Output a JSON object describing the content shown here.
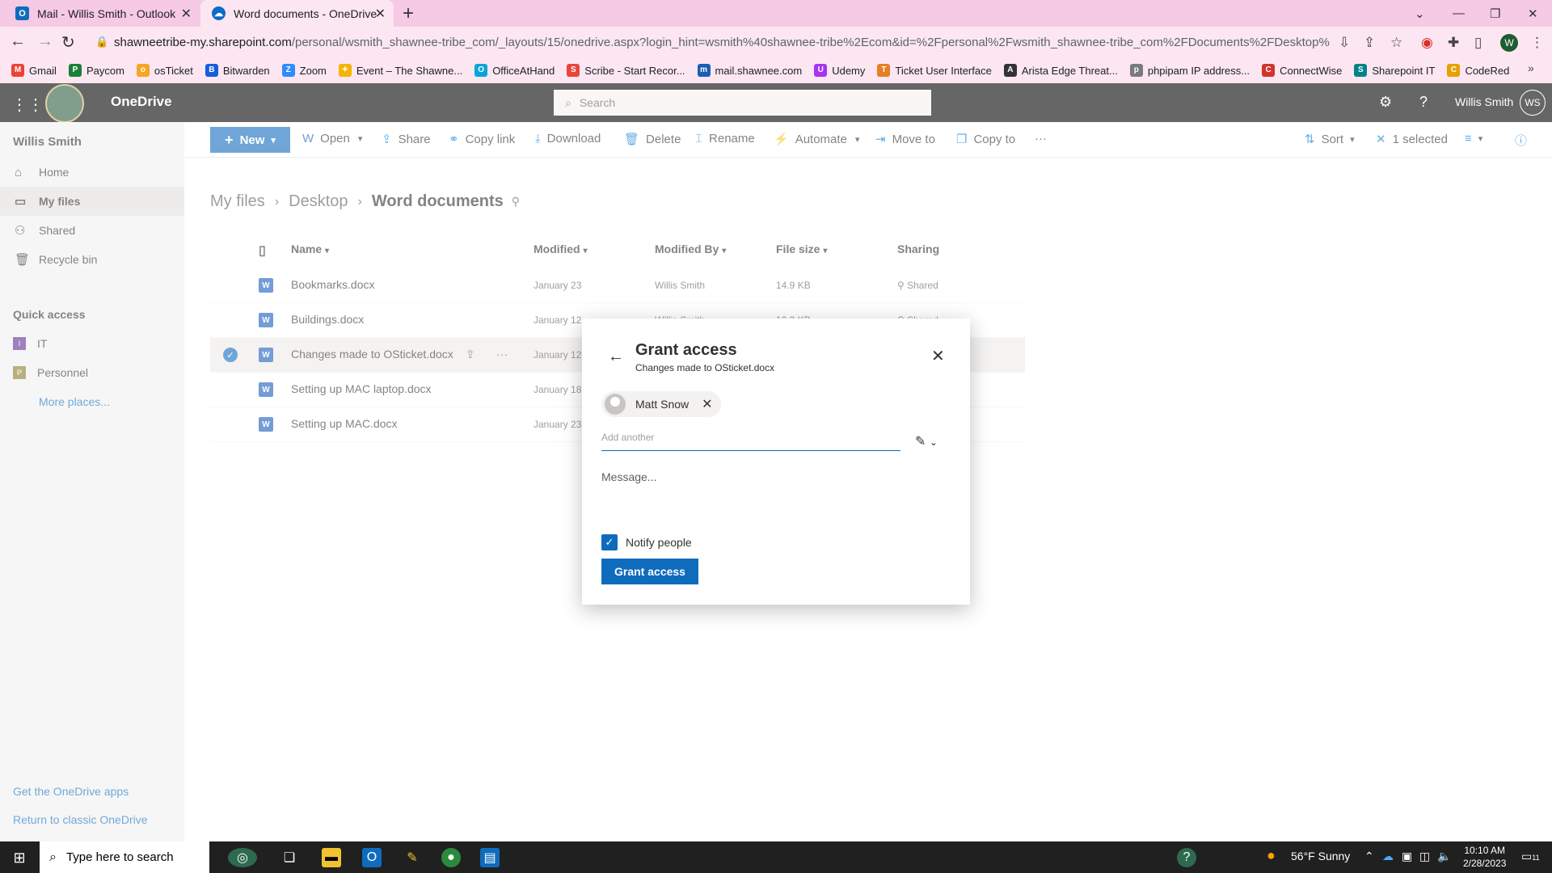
{
  "browser": {
    "tabs": [
      {
        "title": "Mail - Willis Smith - Outlook",
        "icon": "outlook-icon"
      },
      {
        "title": "Word documents - OneDrive",
        "icon": "onedrive-icon"
      }
    ],
    "url_host": "shawneetribe-my.sharepoint.com",
    "url_rest": "/personal/wsmith_shawnee-tribe_com/_layouts/15/onedrive.aspx?login_hint=wsmith%40shawnee-tribe%2Ecom&id=%2Fpersonal%2Fwsmith_shawnee-tribe_com%2FDocuments%2FDesktop%2FWord%20docu...",
    "profile_initial": "W",
    "bookmarks": [
      {
        "label": "Gmail",
        "color": "#ea4335",
        "glyph": "M"
      },
      {
        "label": "Paycom",
        "color": "#1a7f37",
        "glyph": "P"
      },
      {
        "label": "osTicket",
        "color": "#f5a623",
        "glyph": "o"
      },
      {
        "label": "Bitwarden",
        "color": "#175ddc",
        "glyph": "B"
      },
      {
        "label": "Zoom",
        "color": "#2d8cff",
        "glyph": "Z"
      },
      {
        "label": "Event – The Shawne...",
        "color": "#f4b400",
        "glyph": "✦"
      },
      {
        "label": "OfficeAtHand",
        "color": "#0aa5d8",
        "glyph": "O"
      },
      {
        "label": "Scribe - Start Recor...",
        "color": "#e8453c",
        "glyph": "S"
      },
      {
        "label": "mail.shawnee.com",
        "color": "#1a5fb4",
        "glyph": "m"
      },
      {
        "label": "Udemy",
        "color": "#a435f0",
        "glyph": "U"
      },
      {
        "label": "Ticket User Interface",
        "color": "#e67e22",
        "glyph": "T"
      },
      {
        "label": "Arista Edge Threat...",
        "color": "#333333",
        "glyph": "A"
      },
      {
        "label": "phpipam IP address...",
        "color": "#7a7a7a",
        "glyph": "p"
      },
      {
        "label": "ConnectWise",
        "color": "#d0342c",
        "glyph": "C"
      },
      {
        "label": "Sharepoint IT",
        "color": "#038387",
        "glyph": "S"
      },
      {
        "label": "CodeRed",
        "color": "#e5a100",
        "glyph": "C"
      }
    ]
  },
  "header": {
    "app_name": "OneDrive",
    "search_placeholder": "Search",
    "user_name": "Willis Smith",
    "user_initials": "WS"
  },
  "sidebar": {
    "owner": "Willis Smith",
    "items": [
      {
        "label": "Home",
        "icon": "home-icon",
        "glyph": "⌂"
      },
      {
        "label": "My files",
        "icon": "folder-icon",
        "glyph": "▭"
      },
      {
        "label": "Shared",
        "icon": "people-icon",
        "glyph": "⚇"
      },
      {
        "label": "Recycle bin",
        "icon": "trash-icon",
        "glyph": "🗑"
      }
    ],
    "quick_access_title": "Quick access",
    "quick_access": [
      {
        "label": "IT",
        "color": "#5c2e91",
        "glyph": "I"
      },
      {
        "label": "Personnel",
        "color": "#8a7a2e",
        "glyph": "P"
      }
    ],
    "more_places": "More places...",
    "get_apps": "Get the OneDrive apps",
    "return_classic": "Return to classic OneDrive"
  },
  "commands": {
    "new": "New",
    "open": "Open",
    "share": "Share",
    "copy_link": "Copy link",
    "download": "Download",
    "delete": "Delete",
    "rename": "Rename",
    "automate": "Automate",
    "move_to": "Move to",
    "copy_to": "Copy to",
    "more": "···",
    "sort": "Sort",
    "selected": "1 selected"
  },
  "breadcrumb": {
    "items": [
      "My files",
      "Desktop"
    ],
    "current": "Word documents"
  },
  "columns": {
    "name": "Name",
    "modified": "Modified",
    "modified_by": "Modified By",
    "file_size": "File size",
    "sharing": "Sharing"
  },
  "files": [
    {
      "name": "Bookmarks.docx",
      "modified": "January 23",
      "modified_by": "Willis Smith",
      "size": "14.9 KB",
      "sharing": "Shared",
      "selected": false
    },
    {
      "name": "Buildings.docx",
      "modified": "January 12",
      "modified_by": "Willis Smith",
      "size": "12.2 KB",
      "sharing": "Shared",
      "selected": false
    },
    {
      "name": "Changes made to OSticket.docx",
      "modified": "January 12",
      "modified_by": "",
      "size": "",
      "sharing": "",
      "selected": true
    },
    {
      "name": "Setting up MAC laptop.docx",
      "modified": "January 18",
      "modified_by": "",
      "size": "",
      "sharing": "",
      "selected": false
    },
    {
      "name": "Setting up MAC.docx",
      "modified": "January 23",
      "modified_by": "",
      "size": "",
      "sharing": "",
      "selected": false
    }
  ],
  "dialog": {
    "title": "Grant access",
    "subtitle": "Changes made to OSticket.docx",
    "person": "Matt Snow",
    "add_placeholder": "Add another",
    "message_placeholder": "Message...",
    "notify_label": "Notify people",
    "notify_checked": true,
    "button": "Grant access"
  },
  "taskbar": {
    "search_placeholder": "Type here to search",
    "weather": "56°F  Sunny",
    "time": "10:10 AM",
    "date": "2/28/2023",
    "notif_count": "11"
  },
  "colors": {
    "accent": "#0f6cbd",
    "browser_chrome": "#fbe6f2"
  }
}
